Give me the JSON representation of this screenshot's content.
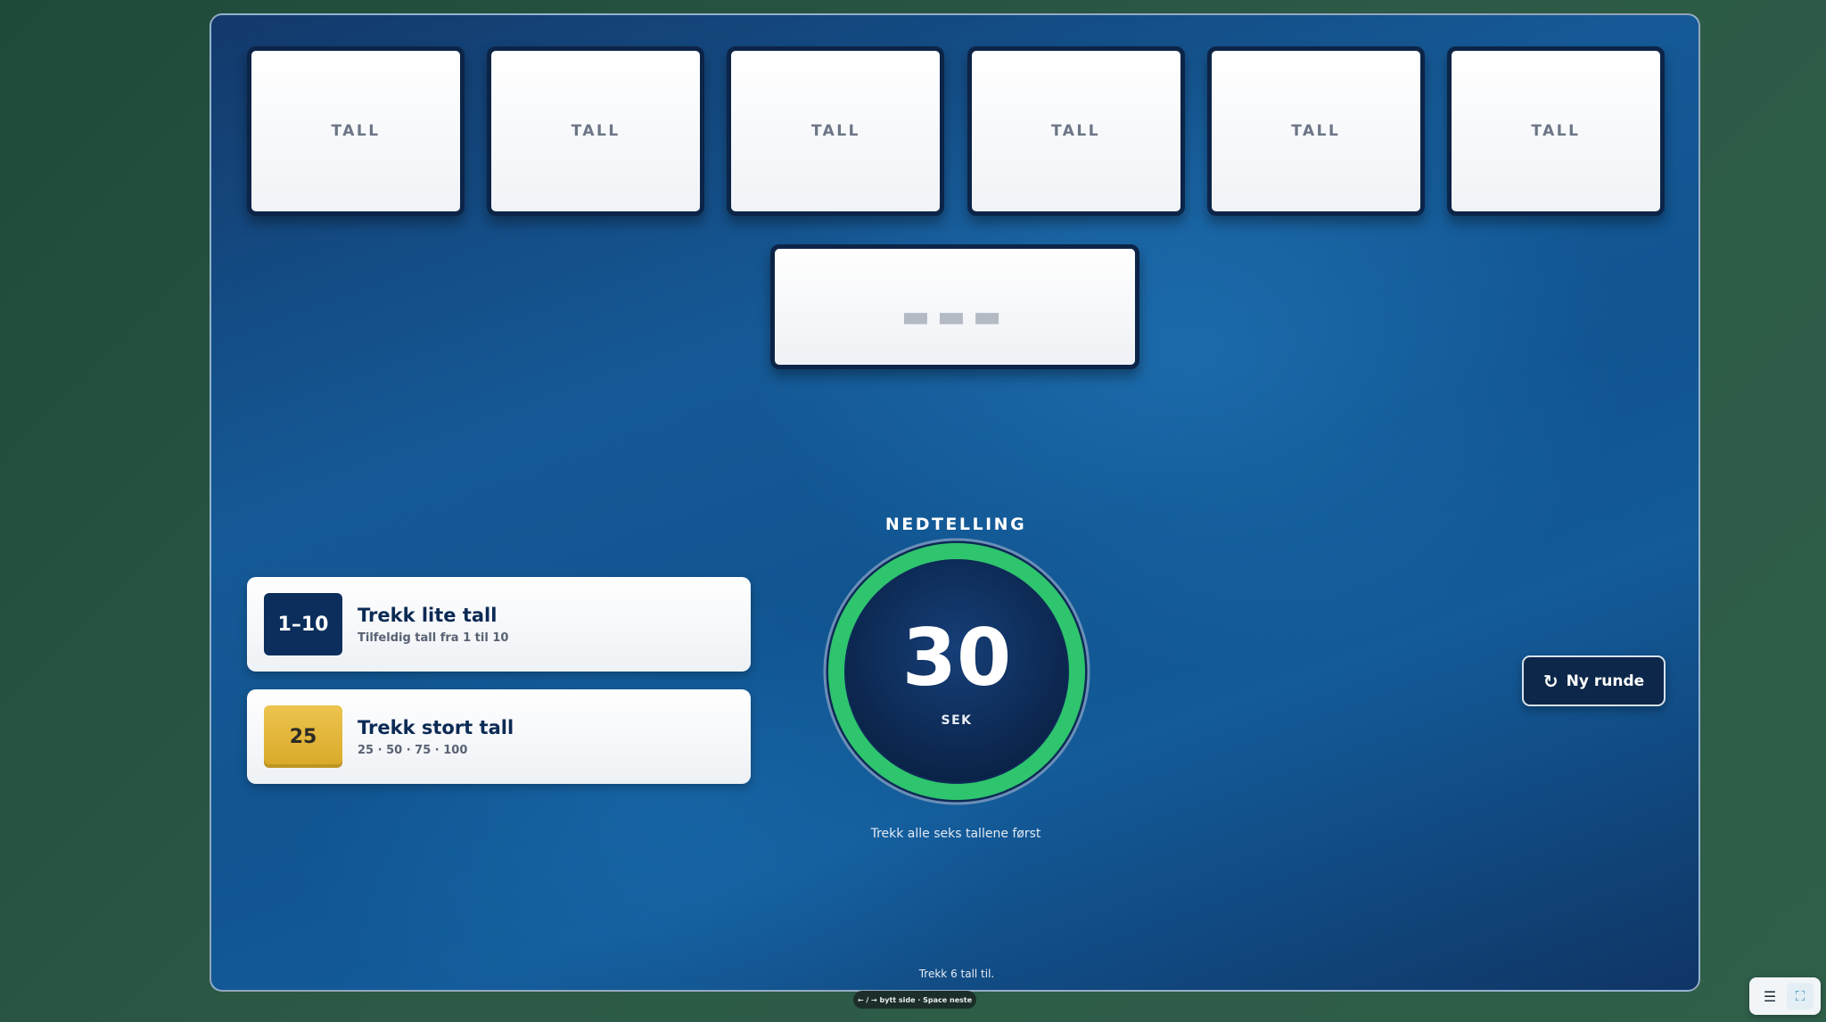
{
  "tiles": [
    {
      "label": "TALL"
    },
    {
      "label": "TALL"
    },
    {
      "label": "TALL"
    },
    {
      "label": "TALL"
    },
    {
      "label": "TALL"
    },
    {
      "label": "TALL"
    }
  ],
  "target": {
    "placeholder": "▬▬▬"
  },
  "actions": {
    "small": {
      "badge": "1–10",
      "title": "Trekk lite tall",
      "subtitle": "Tilfeldig tall fra 1 til 10"
    },
    "large": {
      "badge": "25",
      "title": "Trekk stort tall",
      "subtitle": "25 · 50 · 75 · 100"
    }
  },
  "timer": {
    "label": "NEDTELLING",
    "seconds": "30",
    "unit": "SEK",
    "hint": "Trekk alle seks tallene først",
    "progress": 1.0,
    "ring_color": "#2fc46e"
  },
  "new_round": {
    "icon": "refresh-icon",
    "label": "Ny runde"
  },
  "status": "Trekk 6 tall til.",
  "keyboard_hint": "← / → bytt side · Space neste",
  "corner": {
    "menu_icon": "☰",
    "fullscreen_icon": "⛶"
  }
}
